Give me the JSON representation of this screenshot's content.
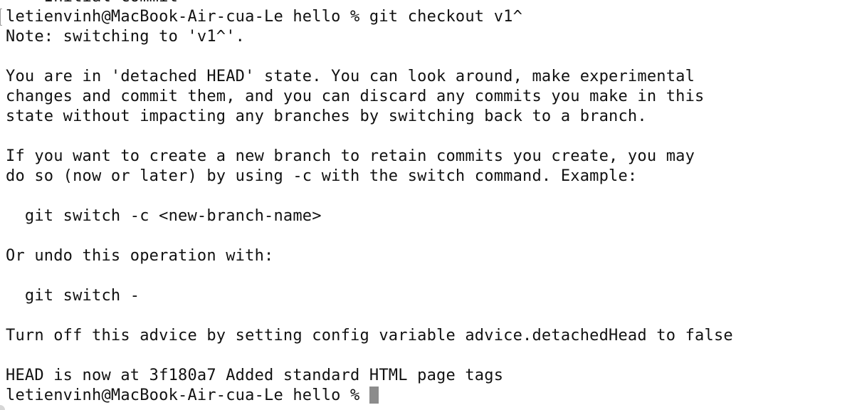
{
  "terminal": {
    "lines": [
      "    Initial commit",
      "letienvinh@MacBook-Air-cua-Le hello % git checkout v1^",
      "Note: switching to 'v1^'.",
      "",
      "You are in 'detached HEAD' state. You can look around, make experimental",
      "changes and commit them, and you can discard any commits you make in this",
      "state without impacting any branches by switching back to a branch.",
      "",
      "If you want to create a new branch to retain commits you create, you may",
      "do so (now or later) by using -c with the switch command. Example:",
      "",
      "  git switch -c <new-branch-name>",
      "",
      "Or undo this operation with:",
      "",
      "  git switch -",
      "",
      "Turn off this advice by setting config variable advice.detachedHead to false",
      "",
      "HEAD is now at 3f180a7 Added standard HTML page tags"
    ],
    "prompt": "letienvinh@MacBook-Air-cua-Le hello % ",
    "cursor_color": "#8c8c8c",
    "text_color": "#111111",
    "background_color": "#ffffff"
  }
}
